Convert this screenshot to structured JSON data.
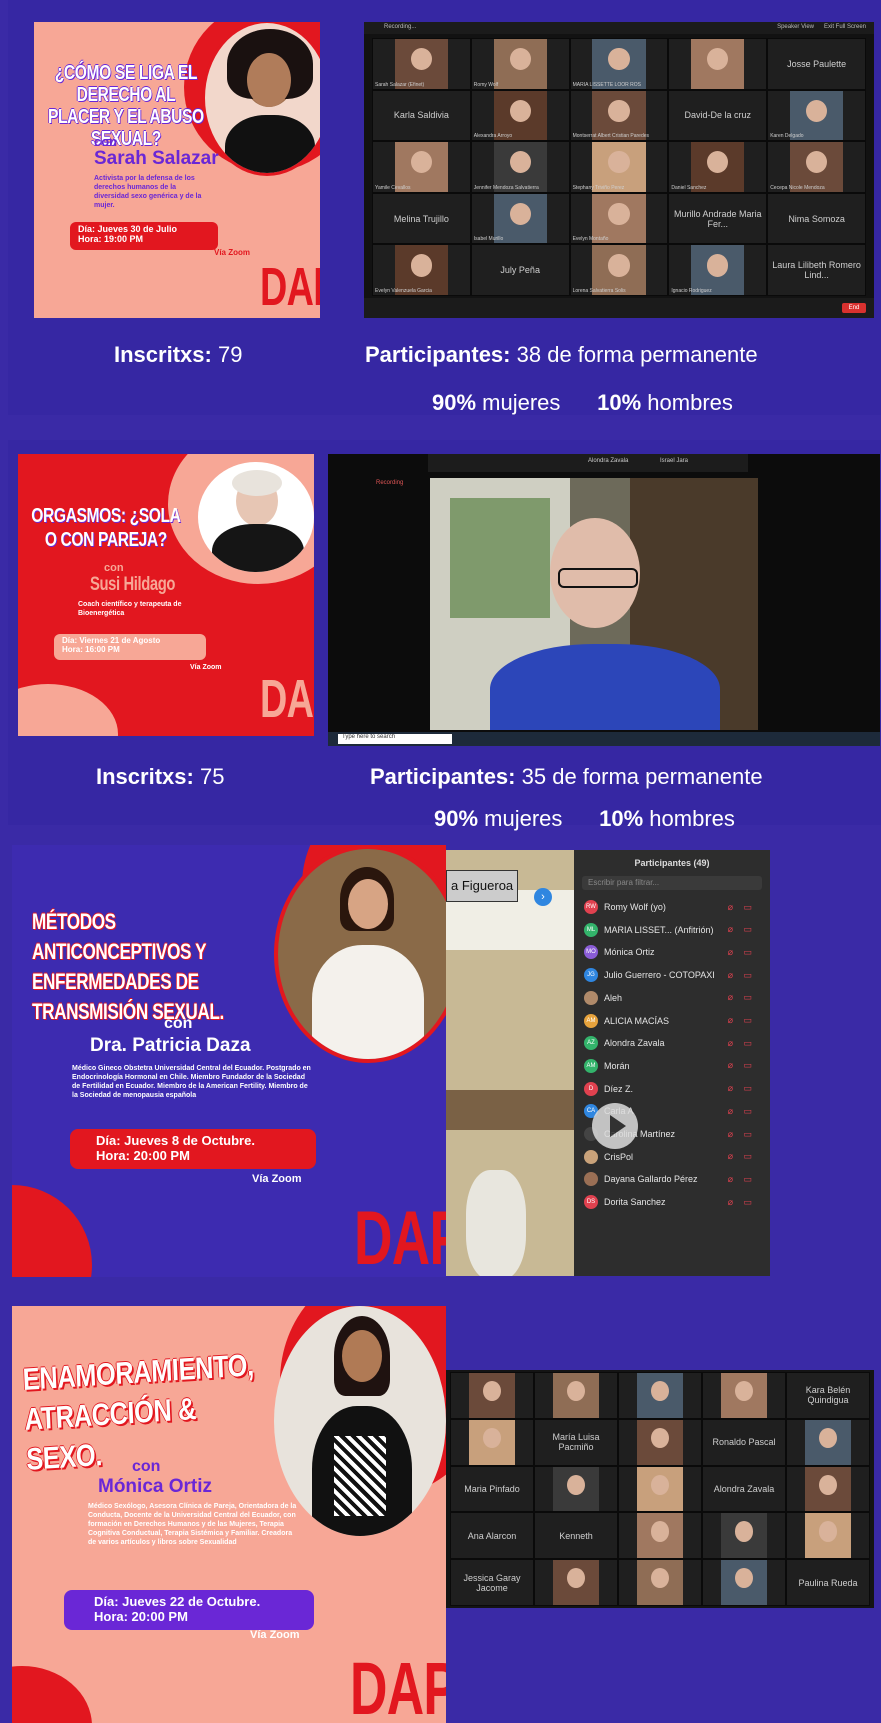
{
  "sections": [
    {
      "poster": {
        "title": "¿CÓMO SE LIGA EL DERECHO AL PLACER Y EL ABUSO SEXUAL?",
        "con": "con",
        "speaker": "Sarah Salazar",
        "bio": "Activista por la defensa de los derechos humanos de la diversidad sexo genérica y de la mujer.",
        "day": "Día: Jueves 30 de Julio",
        "time": "Hora: 19:00 PM",
        "via": "Vía Zoom",
        "logo": "DAP"
      },
      "zoom_names": [
        "Sarah Salazar (Efinet)",
        "Romy Wolf",
        "MARIA LISSETTE LOOR ROS",
        "",
        "Josse Paulette",
        "Karla Saldivia",
        "Alexandra Arroyo",
        "Montserrat Albert Cristian Paredes",
        "David-De la cruz",
        "Karen Delgado",
        "Yamile Cevallos",
        "Jennifer Mendoza Salvatierra",
        "Stephany Triviño Perez",
        "Daniel Sanchez",
        "Cecepa Nicole Mendoza",
        "Melina Trujillo",
        "Isabel Murillo",
        "Evelyn Montaño",
        "Murillo Andrade Maria Fer...",
        "Nima Somoza",
        "Evelyn Valenzuela Garcia",
        "July Peña",
        "Lorena Salvatierra Solis",
        "Ignacio Rodriguez",
        "Laura Lilibeth Romero Lind..."
      ],
      "zoom_ui": {
        "recording": "Recording...",
        "speaker_view": "Speaker View",
        "exit_fullscreen": "Exit Full Screen",
        "end": "End"
      },
      "inscritos_label": "Inscritxs:",
      "inscritos_value": "79",
      "participantes_label": "Participantes:",
      "participantes_value": "38 de forma permanente",
      "women_pct": "90%",
      "women_label": "mujeres",
      "men_pct": "10%",
      "men_label": "hombres"
    },
    {
      "poster": {
        "title": "ORGASMOS: ¿SOLA O CON PAREJA?",
        "con": "con",
        "speaker": "Susi Hildago",
        "bio": "Coach científico y terapeuta de Bioenergética",
        "day": "Día: Viernes 21 de Agosto",
        "time": "Hora: 16:00 PM",
        "via": "Vía Zoom",
        "logo": "DAP"
      },
      "zoom_top": [
        "Alondra Zavala",
        "Israel Jara"
      ],
      "recording": "Recording",
      "search_placeholder": "Type here to search",
      "inscritos_label": "Inscritxs:",
      "inscritos_value": "75",
      "participantes_label": "Participantes:",
      "participantes_value": "35 de forma permanente",
      "women_pct": "90%",
      "women_label": "mujeres",
      "men_pct": "10%",
      "men_label": "hombres"
    },
    {
      "poster": {
        "title": "MÉTODOS ANTICONCEPTIVOS Y ENFERMEDADES DE TRANSMISIÓN SEXUAL.",
        "con": "con",
        "speaker": "Dra. Patricia Daza",
        "bio": "Médico Gineco Obstetra Universidad Central del Ecuador. Postgrado en Endocrinología Hormonal en Chile. Miembro Fundador de la Sociedad de Fertilidad en Ecuador. Miembro de la American Fertility. Miembro de la Sociedad de menopausia española",
        "day": "Día: Jueves 8 de Octubre.",
        "time": "Hora: 20:00 PM",
        "via": "Vía Zoom",
        "logo": "DAP"
      },
      "speaker_tile": "a Figueroa",
      "panel_title": "Participantes (49)",
      "panel_search": "Escribir para filtrar...",
      "participants": [
        {
          "initials": "RW",
          "name": "Romy Wolf (yo)",
          "color": "#e0414f"
        },
        {
          "initials": "ML",
          "name": "MARIA LISSET... (Anfitrión)",
          "color": "#33b36b"
        },
        {
          "initials": "MO",
          "name": "Mónica Ortiz",
          "color": "#8a5cd6"
        },
        {
          "initials": "JG",
          "name": "Julio Guerrero - COTOPAXI",
          "color": "#2f86e0"
        },
        {
          "initials": "",
          "name": "Aleh",
          "color": "#b08a6a"
        },
        {
          "initials": "AM",
          "name": "ALICIA MACÍAS",
          "color": "#e6a23c"
        },
        {
          "initials": "AZ",
          "name": "Alondra Zavala",
          "color": "#33b36b"
        },
        {
          "initials": "AM",
          "name": "Morán",
          "color": "#33b36b"
        },
        {
          "initials": "D",
          "name": "Díez Z.",
          "color": "#e0414f"
        },
        {
          "initials": "CA",
          "name": "Carla A",
          "color": "#2f86e0"
        },
        {
          "initials": "",
          "name": "Carolina Martínez",
          "color": "#444444"
        },
        {
          "initials": "",
          "name": "CrisPol",
          "color": "#c9a27a"
        },
        {
          "initials": "",
          "name": "Dayana Gallardo Pérez",
          "color": "#9a6f55"
        },
        {
          "initials": "DS",
          "name": "Dorita Sanchez",
          "color": "#e0414f"
        }
      ]
    },
    {
      "poster": {
        "title": "ENAMORAMIENTO, ATRACCIÓN & SEXO.",
        "con": "con",
        "speaker": "Mónica Ortiz",
        "bio": "Médico Sexólogo, Asesora Clínica de Pareja, Orientadora de la Conducta, Docente de la Universidad Central del Ecuador, con formación en Derechos Humanos y de las Mujeres, Terapia Cognitiva Conductual, Terapia Sistémica y Familiar. Creadora de varios artículos y libros sobre Sexualidad",
        "day": "Día: Jueves 22 de Octubre.",
        "time": "Hora: 20:00 PM",
        "via": "Vía Zoom",
        "logo": "DAP"
      },
      "zoom_names": [
        "",
        "",
        "",
        "",
        "Kara Belén Quindigua",
        "",
        "María Luisa Pacmiño",
        "",
        "Ronaldo Pascal",
        "",
        "Maria Pinfado",
        "",
        "",
        "Alondra Zavala",
        "",
        "Ana Alarcon",
        "Kenneth",
        "",
        "",
        "",
        "Jessica Garay Jacome",
        "",
        "",
        "",
        "Paulina Rueda"
      ]
    }
  ],
  "colors": {
    "background": "#3a2aa6",
    "salmon": "#f7a796",
    "red": "#e2171f",
    "purple": "#6a27d6",
    "white": "#ffffff"
  }
}
